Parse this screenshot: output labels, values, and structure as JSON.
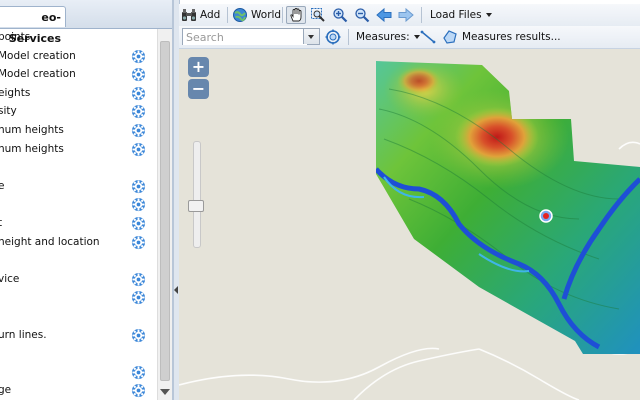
{
  "left_panel": {
    "tab_label": "eo-Services",
    "items": [
      {
        "label": "points",
        "gear": false
      },
      {
        "label": "Model creation",
        "gear": true
      },
      {
        "label": "Model creation",
        "gear": true
      },
      {
        "label": "eights",
        "gear": true
      },
      {
        "label": "sity",
        "gear": true
      },
      {
        "label": "num heights",
        "gear": true
      },
      {
        "label": "num heights",
        "gear": true
      },
      {
        "label": "",
        "gear": false
      },
      {
        "label": "e",
        "gear": true
      },
      {
        "label": "",
        "gear": true
      },
      {
        "label": "t",
        "gear": true
      },
      {
        "label": "height and location",
        "gear": true
      },
      {
        "label": "",
        "gear": false
      },
      {
        "label": "vice",
        "gear": true
      },
      {
        "label": "",
        "gear": true
      },
      {
        "label": "",
        "gear": false
      },
      {
        "label": "urn lines.",
        "gear": true
      },
      {
        "label": "",
        "gear": false
      },
      {
        "label": "",
        "gear": true
      },
      {
        "label": "ge",
        "gear": true
      }
    ],
    "gear_icon": "gear-icon"
  },
  "toolbar": {
    "add_label": "Add",
    "world_label": "World",
    "load_files_label": "Load Files",
    "measures_label": "Measures:",
    "measures_results_label": "Measures results...",
    "search_placeholder": "Search"
  },
  "map": {
    "zoom_in_label": "+",
    "zoom_out_label": "−",
    "zoom_level_fraction": 0.38
  },
  "colors": {
    "accent": "#2b6fbd",
    "map_background": "#e5e3d9",
    "toolbar_bg": "#e6ecf3"
  }
}
